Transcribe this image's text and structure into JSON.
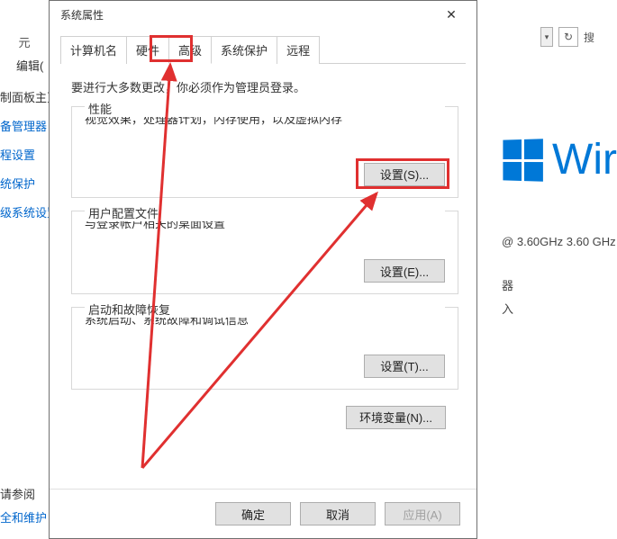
{
  "bg": {
    "breadcrumb_suffix": "元",
    "edit_label": "编辑(",
    "refresh_glyph": "↻",
    "search_label": "搜",
    "left_links": {
      "home": "制面板主页",
      "dev_mgr": "备管理器",
      "remote": "程设置",
      "protection": "统保护",
      "adv_sys": "级系统设置"
    },
    "win_text": "Wir",
    "specs": {
      "cpu": "@ 3.60GHz   3.60 GHz"
    },
    "cat_items": [
      "器",
      "入"
    ],
    "bottom": {
      "see_also": "请参阅",
      "security": "全和维护"
    }
  },
  "dialog": {
    "title": "系统属性",
    "close_glyph": "✕",
    "tabs": [
      "计算机名",
      "硬件",
      "高级",
      "系统保护",
      "远程"
    ],
    "active_tab": 2,
    "notice": "要进行大多数更改，你必须作为管理员登录。",
    "groups": {
      "performance": {
        "legend": "性能",
        "desc": "视觉效果，处理器计划，内存使用，以及虚拟内存",
        "button": "设置(S)..."
      },
      "user_profiles": {
        "legend": "用户配置文件",
        "desc": "与登录帐户相关的桌面设置",
        "button": "设置(E)..."
      },
      "startup": {
        "legend": "启动和故障恢复",
        "desc": "系统启动、系统故障和调试信息",
        "button": "设置(T)..."
      }
    },
    "env_vars_button": "环境变量(N)...",
    "buttons": {
      "ok": "确定",
      "cancel": "取消",
      "apply": "应用(A)"
    }
  }
}
